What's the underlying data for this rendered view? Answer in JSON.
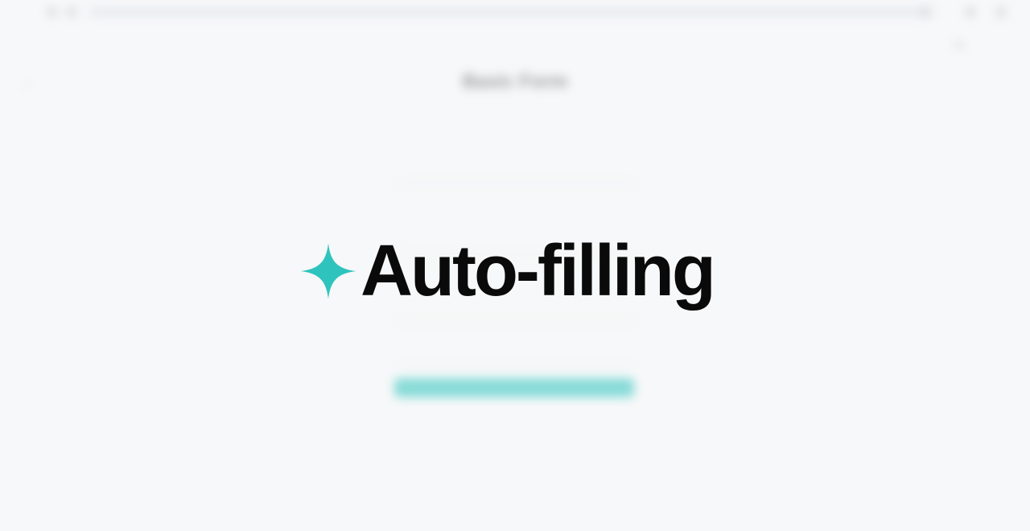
{
  "overlay": {
    "text": "Auto-filling",
    "icon": "sparkle-icon",
    "icon_color": "#2ec4bd",
    "text_color": "#0a0a0a"
  },
  "background_page": {
    "form_title": "Basic Form",
    "form_subtitle": "",
    "accent_color": "#2ec4bd"
  }
}
